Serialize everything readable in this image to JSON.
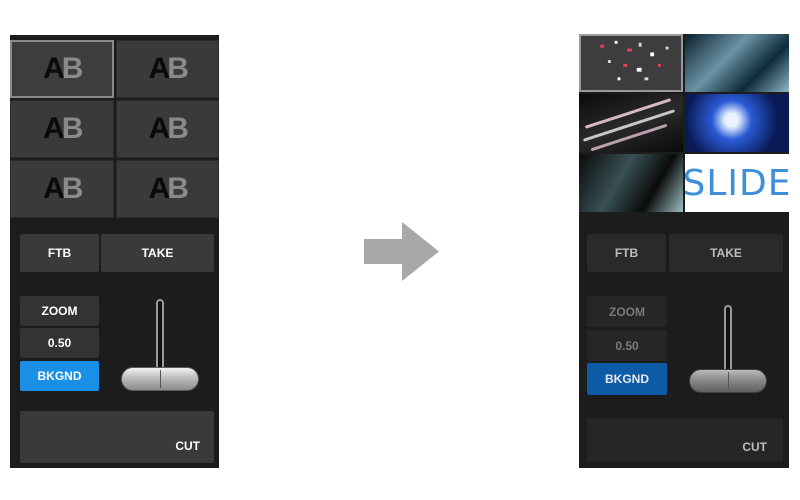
{
  "left_panel": {
    "tiles": [
      {
        "a": "A",
        "b": "B"
      },
      {
        "a": "A",
        "b": "B"
      },
      {
        "a": "A",
        "b": "B"
      },
      {
        "a": "A",
        "b": "B"
      },
      {
        "a": "A",
        "b": "B"
      },
      {
        "a": "A",
        "b": "B"
      }
    ],
    "ftb": "FTB",
    "take": "TAKE",
    "zoom_label": "ZOOM",
    "zoom_value": "0.50",
    "bkgnd": "BKGND",
    "cut": "CUT"
  },
  "right_panel": {
    "slide_text": "SLIDE",
    "ftb": "FTB",
    "take": "TAKE",
    "zoom_label": "ZOOM",
    "zoom_value": "0.50",
    "bkgnd": "BKGND",
    "cut": "CUT"
  },
  "colors": {
    "panel_bg": "#1c1c1c",
    "bkgnd_active": "#1a8fe6",
    "bkgnd_right": "#0d5aa6",
    "arrow": "#a8a8a8",
    "slide_text": "#3d8fd8"
  },
  "icons": {
    "arrow": "right-arrow-icon"
  }
}
